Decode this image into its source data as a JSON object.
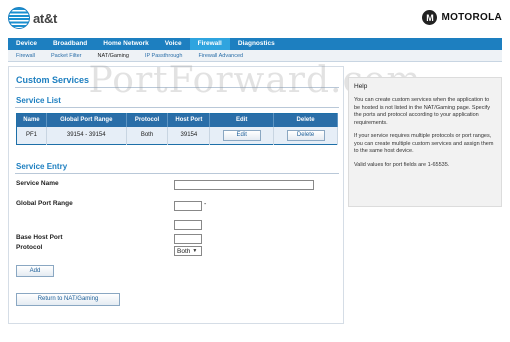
{
  "brand": {
    "att": "at&t",
    "motorola": "MOTOROLA",
    "motorola_mark": "M"
  },
  "nav": {
    "tabs": [
      {
        "label": "Device"
      },
      {
        "label": "Broadband"
      },
      {
        "label": "Home Network"
      },
      {
        "label": "Voice"
      },
      {
        "label": "Firewall"
      },
      {
        "label": "Diagnostics"
      }
    ],
    "active_tab": "Firewall",
    "subtabs": [
      {
        "label": "Firewall"
      },
      {
        "label": "Packet Filter"
      },
      {
        "label": "NAT/Gaming"
      },
      {
        "label": "IP Passthrough"
      },
      {
        "label": "Firewall Advanced"
      }
    ],
    "active_subtab": "NAT/Gaming"
  },
  "watermark": "PortForward.com",
  "page": {
    "title": "Custom Services",
    "service_list_title": "Service List",
    "table": {
      "headers": [
        "Name",
        "Global Port Range",
        "Protocol",
        "Host Port",
        "Edit",
        "Delete"
      ],
      "rows": [
        {
          "name": "PF1",
          "range": "39154 - 39154",
          "protocol": "Both",
          "host_port": "39154",
          "edit": "Edit",
          "delete": "Delete"
        }
      ]
    },
    "service_entry_title": "Service Entry",
    "form": {
      "service_name_label": "Service Name",
      "service_name_value": "",
      "global_port_range_label": "Global Port Range",
      "range_separator": "-",
      "range_start": "",
      "range_end": "",
      "base_host_port_label": "Base Host Port",
      "base_host_port_value": "",
      "protocol_label": "Protocol",
      "protocol_value": "Both",
      "add_label": "Add",
      "return_label": "Return to NAT/Gaming"
    }
  },
  "help": {
    "title": "Help",
    "para1": "You can create custom services when the application to be hosted is not listed in the NAT/Gaming page. Specify the ports and protocol according to your application requirements.",
    "para2": "If your service requires multiple protocols or port ranges, you can create multiple custom services and assign them to the same host device.",
    "para3": "Valid values for port fields are 1-65535."
  },
  "colors": {
    "nav_bg": "#1d7fc0",
    "nav_active": "#2fa4df",
    "accent": "#1d7fc0",
    "table_header": "#2a6ea8"
  }
}
